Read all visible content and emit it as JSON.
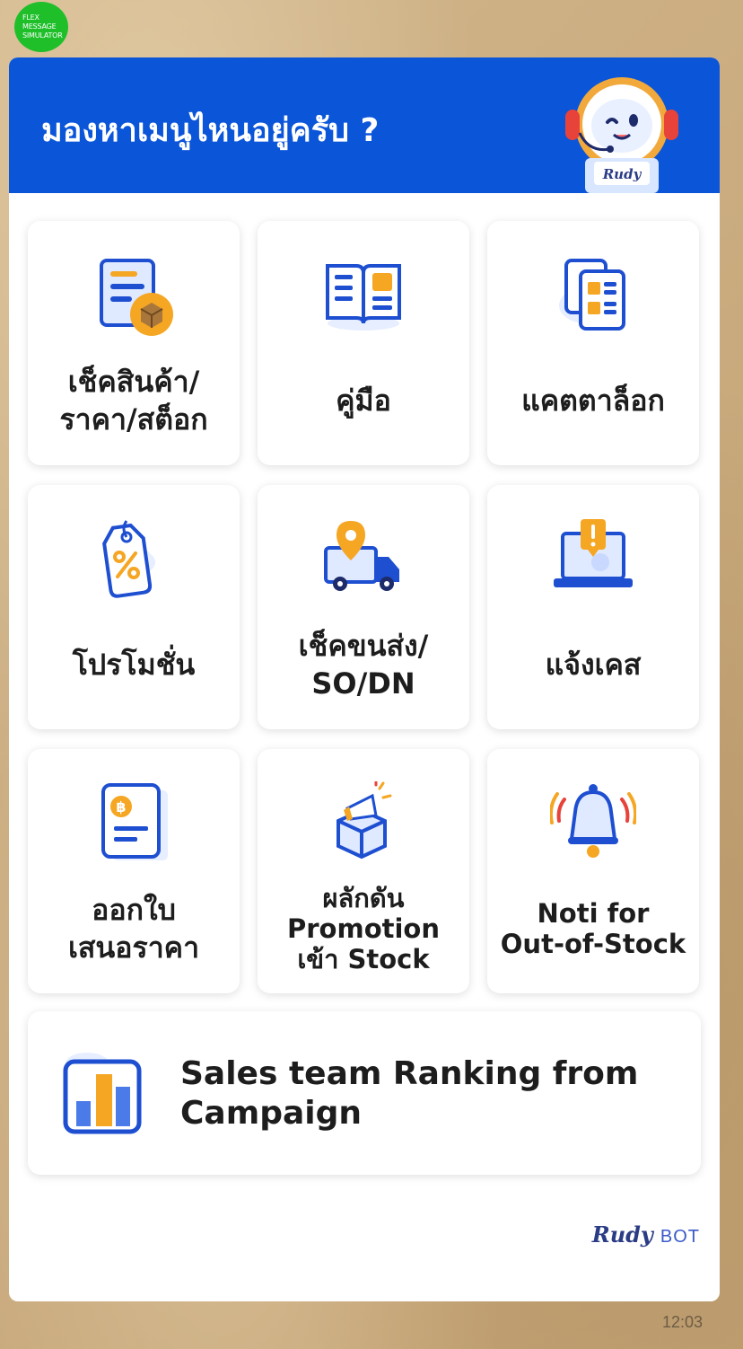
{
  "simulator_badge": [
    "FLEX",
    "MESSAGE",
    "SIMULATOR"
  ],
  "header": {
    "title": "มองหาเมนูไหนอยู่ครับ ?",
    "mascot_label": "Rudy",
    "background_color": "#0b55d9"
  },
  "menu": [
    {
      "label": "เช็คสินค้า/\nราคา/สต็อก",
      "icon": "product-box-document-icon"
    },
    {
      "label": "คู่มือ",
      "icon": "open-book-icon"
    },
    {
      "label": "แคตตาล็อก",
      "icon": "catalog-pages-icon"
    },
    {
      "label": "โปรโมชั่น",
      "icon": "discount-tag-icon"
    },
    {
      "label": "เช็คขนส่ง/\nSO/DN",
      "icon": "delivery-truck-location-icon"
    },
    {
      "label": "แจ้งเคส",
      "icon": "laptop-alert-icon"
    },
    {
      "label": "ออกใบ\nเสนอราคา",
      "icon": "quotation-document-icon"
    },
    {
      "label": "ผลักดัน\nPromotion\nเข้า Stock",
      "icon": "megaphone-box-icon"
    },
    {
      "label": "Noti for\nOut-of-Stock",
      "icon": "ringing-bell-icon"
    }
  ],
  "wide_item": {
    "label": "Sales team Ranking from\nCampaign",
    "icon": "bar-chart-icon"
  },
  "brand": {
    "name": "Rudy",
    "suffix": "BOT"
  },
  "timestamp": "12:03"
}
